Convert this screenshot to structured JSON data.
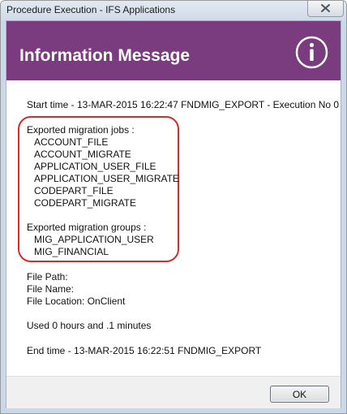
{
  "window": {
    "title": "Procedure Execution - IFS Applications"
  },
  "header": {
    "title": "Information Message",
    "icon": "info-icon"
  },
  "message": {
    "start_line": "Start time - 13-MAR-2015 16:22:47   FNDMIG_EXPORT - Execution No 0",
    "jobs_heading": "Exported migration jobs :",
    "jobs": [
      "ACCOUNT_FILE",
      "ACCOUNT_MIGRATE",
      "APPLICATION_USER_FILE",
      "APPLICATION_USER_MIGRATE",
      "CODEPART_FILE",
      "CODEPART_MIGRATE"
    ],
    "groups_heading": "Exported migration groups :",
    "groups": [
      "MIG_APPLICATION_USER",
      "MIG_FINANCIAL"
    ],
    "file_path": "File Path:",
    "file_name": "File Name:",
    "file_location": "File Location: OnClient",
    "used_time": "Used 0 hours and .1 minutes",
    "end_line": "End time - 13-MAR-2015 16:22:51   FNDMIG_EXPORT"
  },
  "buttons": {
    "ok": "OK"
  },
  "colors": {
    "header_band": "#7a3b7f",
    "highlight_border": "#d62b2b",
    "frame": "#c9d9ea"
  }
}
